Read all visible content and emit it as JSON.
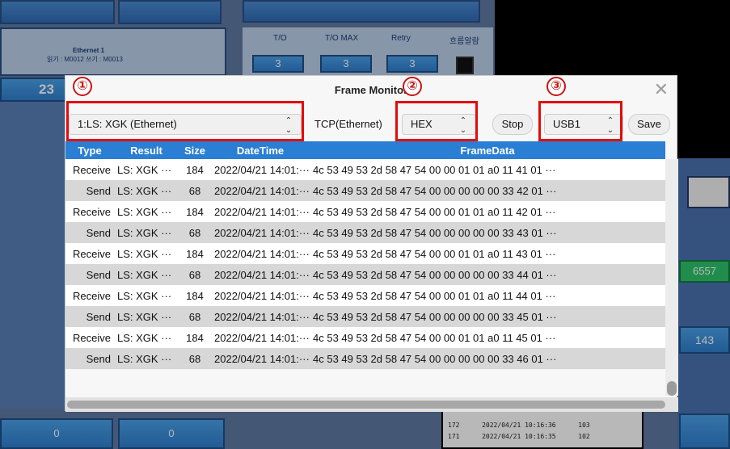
{
  "background": {
    "ethernet_label": "Ethernet 1",
    "read_write_label": "읽기 : M0012  쓰기 : M0013",
    "left_value": "23",
    "to_label": "T/O",
    "to_max_label": "T/O MAX",
    "retry_label": "Retry",
    "comm_label": "흐름알람",
    "to_value": "3",
    "to_max_value": "3",
    "retry_value": "3",
    "right_value_1": "6557",
    "right_value_2": "143",
    "bottom_left_value_1": "0",
    "bottom_left_value_2": "0",
    "bottom_table_rows": [
      [
        "172",
        "2022/04/21  10:16:36",
        "103"
      ],
      [
        "171",
        "2022/04/21  10:16:35",
        "102"
      ]
    ]
  },
  "dialog": {
    "title": "Frame Monitor",
    "device_select": "1:LS: XGK (Ethernet)",
    "protocol_label": "TCP(Ethernet)",
    "format_select": "HEX",
    "stop_button": "Stop",
    "usb_select": "USB1",
    "save_button": "Save",
    "badges": [
      "①",
      "②",
      "③"
    ],
    "columns": [
      "Type",
      "Result",
      "Size",
      "DateTime",
      "FrameData"
    ],
    "rows": [
      [
        "Receive",
        "LS: XGK ···",
        "184",
        "2022/04/21 14:01:···",
        "4c 53 49 53 2d 58 47 54 00 00 01 01 a0 11 41 01 ···"
      ],
      [
        "Send",
        "LS: XGK ···",
        "68",
        "2022/04/21 14:01:···",
        "4c 53 49 53 2d 58 47 54 00 00 00 00 00 33 42 01 ···"
      ],
      [
        "Receive",
        "LS: XGK ···",
        "184",
        "2022/04/21 14:01:···",
        "4c 53 49 53 2d 58 47 54 00 00 01 01 a0 11 42 01 ···"
      ],
      [
        "Send",
        "LS: XGK ···",
        "68",
        "2022/04/21 14:01:···",
        "4c 53 49 53 2d 58 47 54 00 00 00 00 00 33 43 01 ···"
      ],
      [
        "Receive",
        "LS: XGK ···",
        "184",
        "2022/04/21 14:01:···",
        "4c 53 49 53 2d 58 47 54 00 00 01 01 a0 11 43 01 ···"
      ],
      [
        "Send",
        "LS: XGK ···",
        "68",
        "2022/04/21 14:01:···",
        "4c 53 49 53 2d 58 47 54 00 00 00 00 00 33 44 01 ···"
      ],
      [
        "Receive",
        "LS: XGK ···",
        "184",
        "2022/04/21 14:01:···",
        "4c 53 49 53 2d 58 47 54 00 00 01 01 a0 11 44 01 ···"
      ],
      [
        "Send",
        "LS: XGK ···",
        "68",
        "2022/04/21 14:01:···",
        "4c 53 49 53 2d 58 47 54 00 00 00 00 00 33 45 01 ···"
      ],
      [
        "Receive",
        "LS: XGK ···",
        "184",
        "2022/04/21 14:01:···",
        "4c 53 49 53 2d 58 47 54 00 00 01 01 a0 11 45 01 ···"
      ],
      [
        "Send",
        "LS: XGK ···",
        "68",
        "2022/04/21 14:01:···",
        "4c 53 49 53 2d 58 47 54 00 00 00 00 00 33 46 01 ···"
      ]
    ]
  },
  "colors": {
    "header_blue": "#2a7fd4",
    "highlight_red": "#e30b0b"
  }
}
